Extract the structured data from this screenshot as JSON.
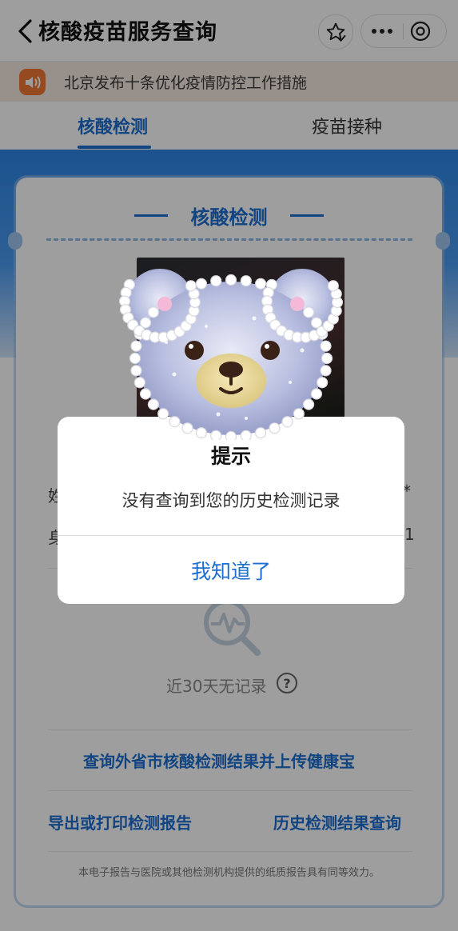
{
  "nav": {
    "title": "核酸疫苗服务查询"
  },
  "notice": {
    "text": "北京发布十条优化疫情防控工作措施"
  },
  "tabs": [
    {
      "label": "核酸检测",
      "active": true
    },
    {
      "label": "疫苗接种",
      "active": false
    }
  ],
  "card": {
    "title": "核酸检测",
    "row1_left": "姓",
    "row1_right": "*",
    "row2_left": "身",
    "row2_right": "1",
    "empty_text": "近30天无记录",
    "help_symbol": "?",
    "link_upload": "查询外省市核酸检测结果并上传健康宝",
    "link_export": "导出或打印检测报告",
    "link_history": "历史检测结果查询",
    "footnote": "本电子报告与医院或其他检测机构提供的纸质报告具有同等效力。"
  },
  "dialog": {
    "title": "提示",
    "message": "没有查询到您的历史检测记录",
    "confirm": "我知道了"
  },
  "colors": {
    "accent": "#1c6fd1",
    "notice_bg": "#f4e9e1",
    "notice_icon": "#f07a32"
  },
  "icons": [
    "back-arrow-icon",
    "star-icon",
    "more-dots-icon",
    "close-circle-icon",
    "speaker-icon",
    "search-chart-icon",
    "help-icon",
    "bear-sticker-icon"
  ]
}
